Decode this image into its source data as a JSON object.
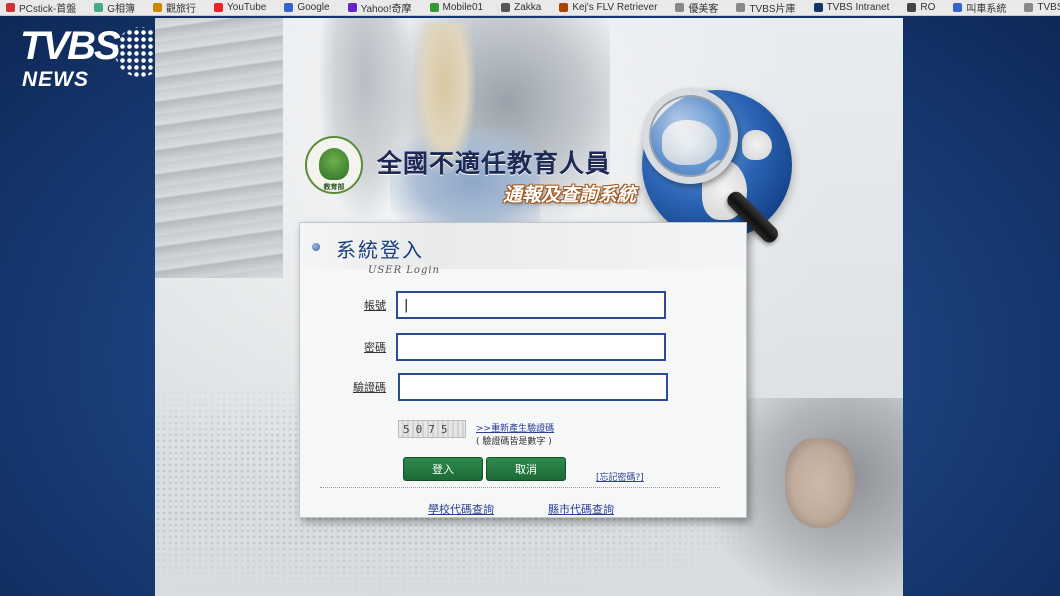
{
  "bookmarks": [
    {
      "label": "PCstick-首盤",
      "icon_color": "#c33"
    },
    {
      "label": "G相簿",
      "icon_color": "#4a8"
    },
    {
      "label": "觀旅行",
      "icon_color": "#c80"
    },
    {
      "label": "YouTube",
      "icon_color": "#e22"
    },
    {
      "label": "Google",
      "icon_color": "#36c"
    },
    {
      "label": "Yahoo!奇摩",
      "icon_color": "#62c"
    },
    {
      "label": "Mobile01",
      "icon_color": "#393"
    },
    {
      "label": "Zakka",
      "icon_color": "#555"
    },
    {
      "label": "Kej's FLV Retriever",
      "icon_color": "#a40"
    },
    {
      "label": "優美客",
      "icon_color": "#888"
    },
    {
      "label": "TVBS片庫",
      "icon_color": "#888"
    },
    {
      "label": "TVBS Intranet",
      "icon_color": "#136"
    },
    {
      "label": "RO",
      "icon_color": "#444"
    },
    {
      "label": "叫車系統",
      "icon_color": "#36c"
    },
    {
      "label": "TVBS",
      "icon_color": "#888"
    }
  ],
  "watermark": {
    "line1": "TVBS",
    "line2": "NEWS"
  },
  "site": {
    "emblem_text": "教育部",
    "title_main": "全國不適任教育人員",
    "title_sub": "通報及查詢系統"
  },
  "login": {
    "title": "系統登入",
    "subtitle": "USER Login",
    "account_label": "帳號",
    "account_value": "|",
    "password_label": "密碼",
    "password_value": "",
    "captcha_label": "驗證碼",
    "captcha_value": "",
    "captcha_image_text": "5075",
    "regenerate_link": ">>重新產生驗證碼",
    "captcha_hint": "( 驗證碼皆是數字 )",
    "login_button": "登入",
    "cancel_button": "取消",
    "forgot_link": "[忘記密碼?]",
    "school_code_link": "學校代碼查詢",
    "county_code_link": "縣市代碼查詢"
  },
  "colors": {
    "input_border": "#2b4b9a",
    "button_green": "#1c6a36",
    "title_blue": "#1d3f7a",
    "subtitle_outline": "#a5571e",
    "bezel_blue": "#1a3f7a"
  }
}
